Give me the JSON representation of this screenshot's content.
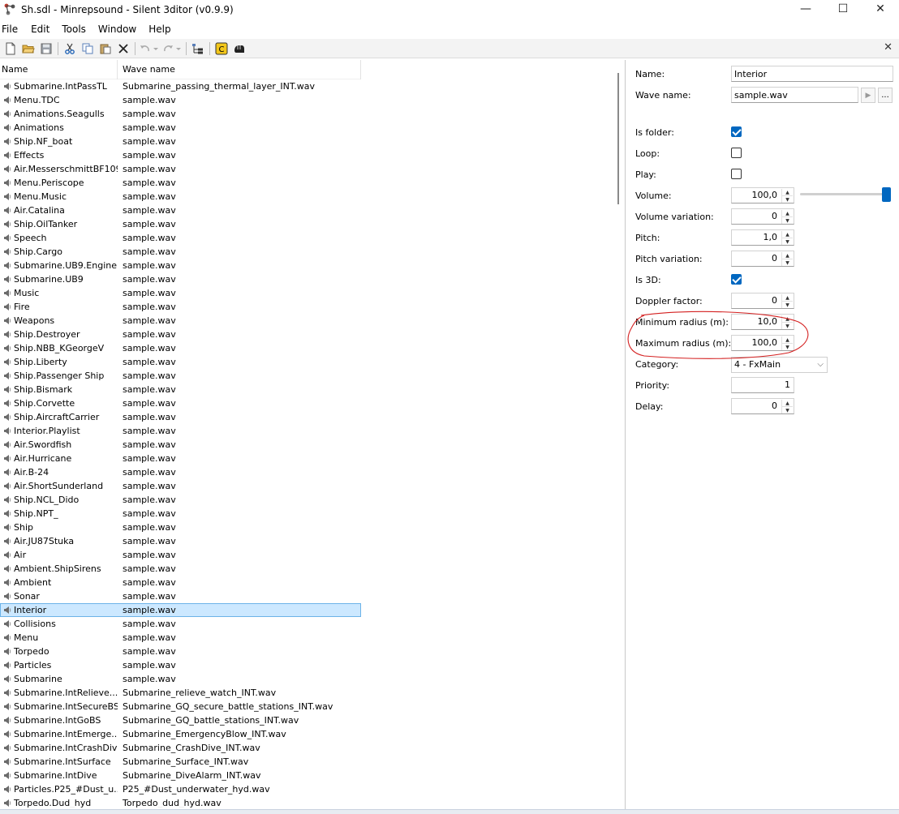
{
  "window": {
    "title": "Sh.sdl - Minrepsound - Silent 3ditor (v0.9.9)",
    "controls": {
      "minimize": "—",
      "maximize": "☐",
      "close": "✕"
    }
  },
  "menu": [
    "File",
    "Edit",
    "Tools",
    "Window",
    "Help"
  ],
  "toolbar": {
    "icons": [
      "new-icon",
      "open-icon",
      "save-icon",
      "cut-icon",
      "copy-icon",
      "paste-icon",
      "delete-icon",
      "undo-icon",
      "redo-icon",
      "tree-icon",
      "sound-icon",
      "hand-icon"
    ],
    "close_label": "✕"
  },
  "list": {
    "columns": [
      "Name",
      "Wave name"
    ],
    "rows": [
      {
        "name": "Submarine.IntPassTL",
        "wave": "Submarine_passing_thermal_layer_INT.wav"
      },
      {
        "name": "Menu.TDC",
        "wave": "sample.wav"
      },
      {
        "name": "Animations.Seagulls",
        "wave": "sample.wav"
      },
      {
        "name": "Animations",
        "wave": "sample.wav"
      },
      {
        "name": "Ship.NF_boat",
        "wave": "sample.wav"
      },
      {
        "name": "Effects",
        "wave": "sample.wav"
      },
      {
        "name": "Air.MesserschmittBF109",
        "wave": "sample.wav"
      },
      {
        "name": "Menu.Periscope",
        "wave": "sample.wav"
      },
      {
        "name": "Menu.Music",
        "wave": "sample.wav"
      },
      {
        "name": "Air.Catalina",
        "wave": "sample.wav"
      },
      {
        "name": "Ship.OilTanker",
        "wave": "sample.wav"
      },
      {
        "name": "Speech",
        "wave": "sample.wav"
      },
      {
        "name": "Ship.Cargo",
        "wave": "sample.wav"
      },
      {
        "name": "Submarine.UB9.Engine",
        "wave": "sample.wav"
      },
      {
        "name": "Submarine.UB9",
        "wave": "sample.wav"
      },
      {
        "name": "Music",
        "wave": "sample.wav"
      },
      {
        "name": "Fire",
        "wave": "sample.wav"
      },
      {
        "name": "Weapons",
        "wave": "sample.wav"
      },
      {
        "name": "Ship.Destroyer",
        "wave": "sample.wav"
      },
      {
        "name": "Ship.NBB_KGeorgeV",
        "wave": "sample.wav"
      },
      {
        "name": "Ship.Liberty",
        "wave": "sample.wav"
      },
      {
        "name": "Ship.Passenger Ship",
        "wave": "sample.wav"
      },
      {
        "name": "Ship.Bismark",
        "wave": "sample.wav"
      },
      {
        "name": "Ship.Corvette",
        "wave": "sample.wav"
      },
      {
        "name": "Ship.AircraftCarrier",
        "wave": "sample.wav"
      },
      {
        "name": "Interior.Playlist",
        "wave": "sample.wav"
      },
      {
        "name": "Air.Swordfish",
        "wave": "sample.wav"
      },
      {
        "name": "Air.Hurricane",
        "wave": "sample.wav"
      },
      {
        "name": "Air.B-24",
        "wave": "sample.wav"
      },
      {
        "name": "Air.ShortSunderland",
        "wave": "sample.wav"
      },
      {
        "name": "Ship.NCL_Dido",
        "wave": "sample.wav"
      },
      {
        "name": "Ship.NPT_",
        "wave": "sample.wav"
      },
      {
        "name": "Ship",
        "wave": "sample.wav"
      },
      {
        "name": "Air.JU87Stuka",
        "wave": "sample.wav"
      },
      {
        "name": "Air",
        "wave": "sample.wav"
      },
      {
        "name": "Ambient.ShipSirens",
        "wave": "sample.wav"
      },
      {
        "name": "Ambient",
        "wave": "sample.wav"
      },
      {
        "name": "Sonar",
        "wave": "sample.wav"
      },
      {
        "name": "Interior",
        "wave": "sample.wav",
        "selected": true
      },
      {
        "name": "Collisions",
        "wave": "sample.wav"
      },
      {
        "name": "Menu",
        "wave": "sample.wav"
      },
      {
        "name": "Torpedo",
        "wave": "sample.wav"
      },
      {
        "name": "Particles",
        "wave": "sample.wav"
      },
      {
        "name": "Submarine",
        "wave": "sample.wav"
      },
      {
        "name": "Submarine.IntRelieve...",
        "wave": "Submarine_relieve_watch_INT.wav"
      },
      {
        "name": "Submarine.IntSecureBS",
        "wave": "Submarine_GQ_secure_battle_stations_INT.wav"
      },
      {
        "name": "Submarine.IntGoBS",
        "wave": "Submarine_GQ_battle_stations_INT.wav"
      },
      {
        "name": "Submarine.IntEmerge...",
        "wave": "Submarine_EmergencyBlow_INT.wav"
      },
      {
        "name": "Submarine.IntCrashDive",
        "wave": "Submarine_CrashDive_INT.wav"
      },
      {
        "name": "Submarine.IntSurface",
        "wave": "Submarine_Surface_INT.wav"
      },
      {
        "name": "Submarine.IntDive",
        "wave": "Submarine_DiveAlarm_INT.wav"
      },
      {
        "name": "Particles.P25_#Dust_u...",
        "wave": "P25_#Dust_underwater_hyd.wav"
      },
      {
        "name": "Torpedo.Dud_hyd",
        "wave": "Torpedo_dud_hyd.wav"
      }
    ]
  },
  "properties": {
    "name_label": "Name:",
    "name_value": "Interior",
    "wave_label": "Wave name:",
    "wave_value": "sample.wav",
    "play_btn": "▶",
    "browse_btn": "...",
    "is_folder_label": "Is folder:",
    "is_folder": true,
    "loop_label": "Loop:",
    "loop": false,
    "play_label": "Play:",
    "play": false,
    "volume_label": "Volume:",
    "volume": "100,0",
    "volume_slider_percent": 100,
    "volume_variation_label": "Volume variation:",
    "volume_variation": "0",
    "pitch_label": "Pitch:",
    "pitch": "1,0",
    "pitch_variation_label": "Pitch variation:",
    "pitch_variation": "0",
    "is3d_label": "Is 3D:",
    "is3d": true,
    "doppler_label": "Doppler factor:",
    "doppler": "0",
    "min_radius_label": "Minimum radius (m):",
    "min_radius": "10,0",
    "max_radius_label": "Maximum radius (m):",
    "max_radius": "100,0",
    "category_label": "Category:",
    "category": "4 - FxMain",
    "priority_label": "Priority:",
    "priority": "1",
    "delay_label": "Delay:",
    "delay": "0"
  },
  "colors": {
    "accent": "#0067c0",
    "selection": "#cce8ff",
    "annotation": "#d42020"
  }
}
